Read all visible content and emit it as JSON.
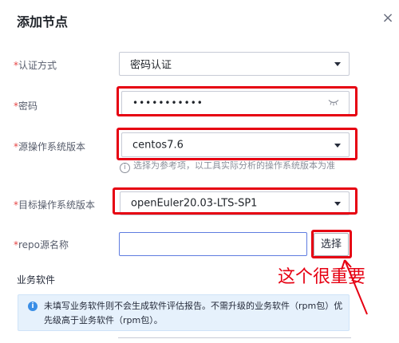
{
  "dialog": {
    "title": "添加节点",
    "close_glyph": "×"
  },
  "form": {
    "required_mark": "*",
    "auth_method": {
      "label": "认证方式",
      "value": "密码认证"
    },
    "password": {
      "label": "密码",
      "value": "•••••••••••"
    },
    "source_os": {
      "label": "源操作系统版本",
      "value": "centos7.6",
      "hint": "选择为参考项，以工具实际分析的操作系统版本为准"
    },
    "target_os": {
      "label": "目标操作系统版本",
      "value": "openEuler20.03-LTS-SP1"
    },
    "repo_name": {
      "label": "repo源名称",
      "value": "",
      "button": "选择"
    }
  },
  "business": {
    "section_title": "业务软件",
    "info": "未填写业务软件则不会生成软件评估报告。不需升级的业务软件（rpm包）优先级高于业务软件（rpm包）。"
  },
  "annotation": {
    "text": "这个很重要",
    "color": "#e60012"
  },
  "colors": {
    "accent_red": "#e60012",
    "info_bg": "#e6f1fc",
    "info_icon": "#3a8ee6",
    "required": "#e54545"
  },
  "icons": {
    "close": "close-icon",
    "dropdown": "chevron-down-icon",
    "password_toggle": "eye-closed-icon",
    "hint": "info-circle-icon",
    "info": "info-filled-icon"
  }
}
